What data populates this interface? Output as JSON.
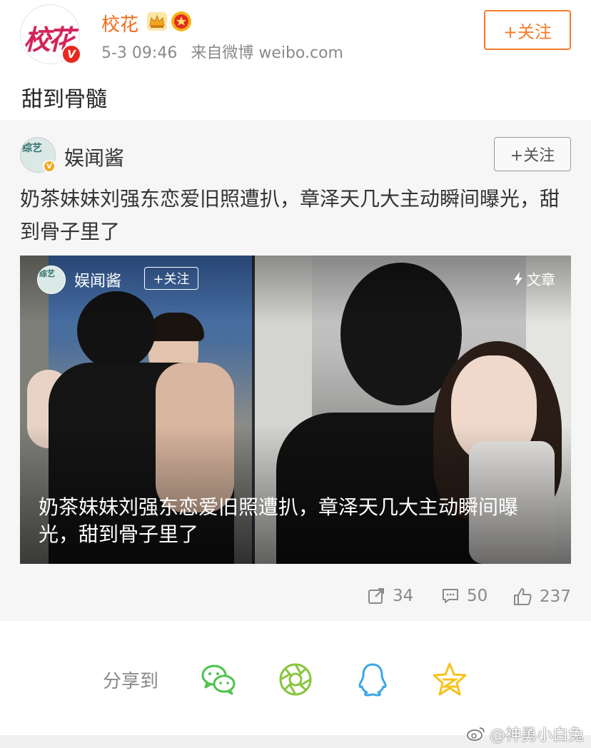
{
  "post": {
    "user_name": "校花",
    "avatar_text": "校花",
    "verified_badge": "V",
    "time": "5-3 09:46",
    "source": "来自微博 weibo.com",
    "follow_label": "+关注",
    "text": "甜到骨髓"
  },
  "repost": {
    "user_name": "娱闻酱",
    "avatar_text": "综艺",
    "verified_badge": "V",
    "follow_label": "+关注",
    "text": "奶茶妹妹刘强东恋爱旧照遭扒，章泽天几大主动瞬间曝光，甜到骨子里了",
    "media": {
      "user_name": "娱闻酱",
      "avatar_text": "综艺",
      "follow_label": "+关注",
      "type_label": "文章",
      "caption": "奶茶妹妹刘强东恋爱旧照遭扒，章泽天几大主动瞬间曝光，甜到骨子里了"
    },
    "stats": {
      "reposts": "34",
      "comments": "50",
      "likes": "237"
    }
  },
  "share": {
    "label": "分享到",
    "targets": [
      "wechat-icon",
      "moments-icon",
      "qq-icon",
      "qzone-icon"
    ]
  },
  "watermark": "@神勇小白兔",
  "colors": {
    "accent_orange": "#f57c2a",
    "name_orange": "#f26b18",
    "wechat_green": "#4cc34b",
    "moments_green": "#8ac53e",
    "qq_blue": "#3aa7e6",
    "qzone_yellow": "#f6c21c"
  }
}
